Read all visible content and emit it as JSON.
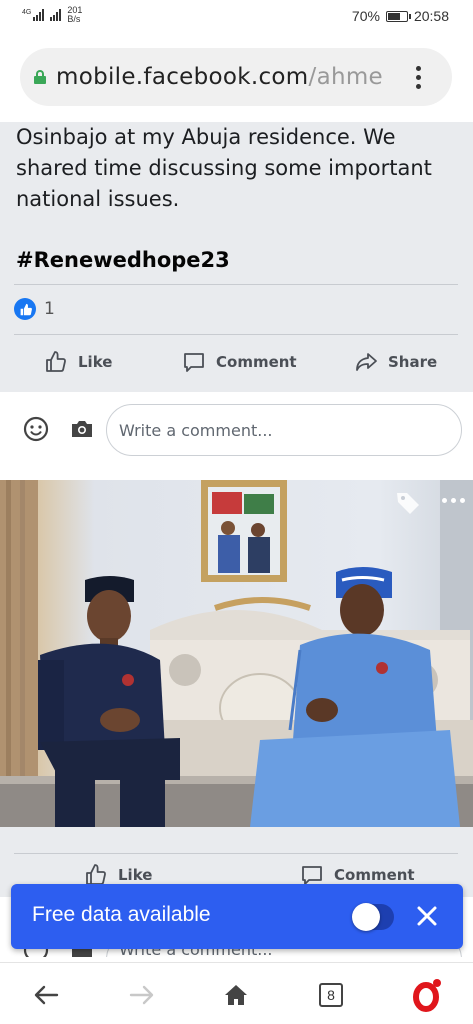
{
  "status_bar": {
    "network_type": "4G",
    "net_speed_value": "201",
    "net_speed_unit": "B/s",
    "battery_percent": "70%",
    "battery_level": 0.7,
    "time": "20:58"
  },
  "browser": {
    "url_host": "mobile.facebook.com",
    "url_path": "/ahme",
    "menu_icon": "kebab-menu-icon"
  },
  "post": {
    "text": "Osinbajo at my Abuja residence. We shared time discussing some important national issues.",
    "hashtag": "#Renewedhope23",
    "reaction_count": "1",
    "actions": {
      "like": "Like",
      "comment": "Comment",
      "share": "Share"
    }
  },
  "comment": {
    "placeholder": "Write a comment..."
  },
  "photo": {
    "tag_icon": "tag-icon",
    "more_icon": "more-horizontal-icon"
  },
  "post_bottom": {
    "like": "Like",
    "comment": "Comment",
    "comment_placeholder": "Write a comment..."
  },
  "toast": {
    "label": "Free data available",
    "toggle_on": false,
    "background": "#2d5ef0"
  },
  "navbar": {
    "tabs_count": "8"
  },
  "colors": {
    "facebook_blue": "#1877f2",
    "feed_background": "#e9ebee",
    "secure_lock": "#3aa757",
    "opera_red": "#e0161c"
  }
}
